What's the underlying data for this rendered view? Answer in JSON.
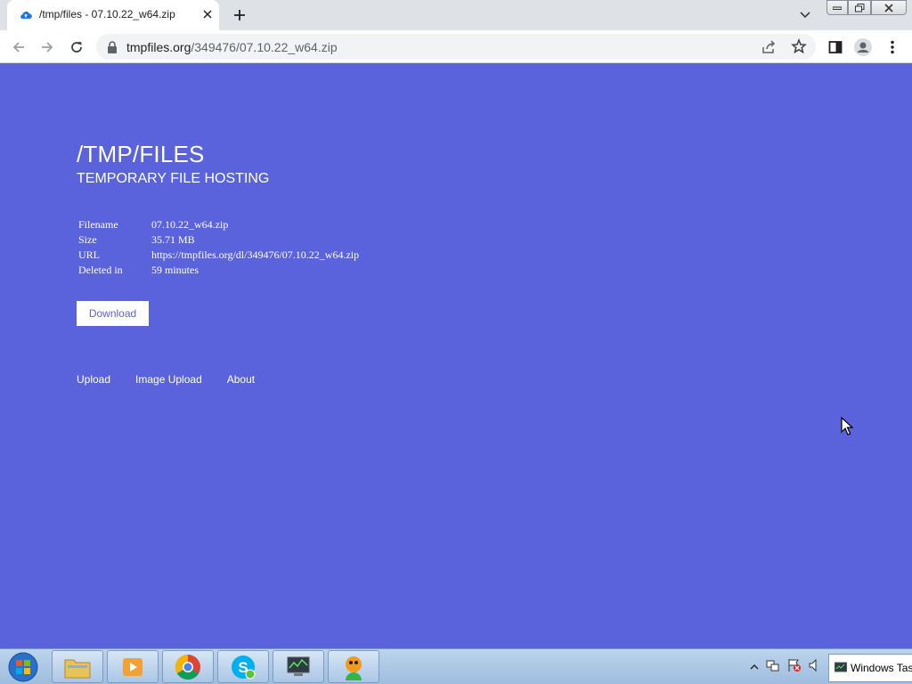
{
  "browser": {
    "tab_title": "/tmp/files - 07.10.22_w64.zip",
    "url_domain": "tmpfiles.org",
    "url_path": "/349476/07.10.22_w64.zip"
  },
  "site": {
    "title": "/TMP/FILES",
    "subtitle": "TEMPORARY FILE HOSTING"
  },
  "file_info": [
    {
      "key": "Filename",
      "value": "07.10.22_w64.zip"
    },
    {
      "key": "Size",
      "value": "35.71 MB"
    },
    {
      "key": "URL",
      "value": "https://tmpfiles.org/dl/349476/07.10.22_w64.zip"
    },
    {
      "key": "Deleted in",
      "value": "59 minutes"
    }
  ],
  "download_label": "Download",
  "footer_links": [
    "Upload",
    "Image Upload",
    "About"
  ],
  "taskbar": {
    "window_label": "Windows Tas"
  },
  "colors": {
    "page_background": "#5a63dc",
    "chrome_tabstrip": "#dee1e6"
  }
}
